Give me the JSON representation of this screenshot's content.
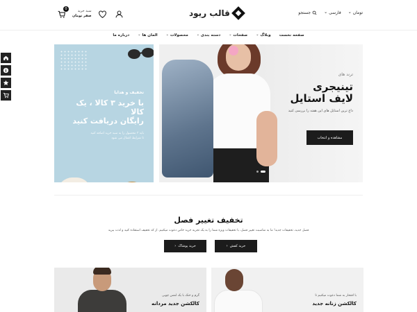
{
  "header": {
    "logo_text": "قالب ریود",
    "cart_label": "سبد خرید",
    "cart_amount": "صفر تومان",
    "cart_count": "0",
    "search_label": "جستجو",
    "language": "فارسی",
    "currency": "تومان"
  },
  "nav": {
    "items": [
      "صفحه نخست",
      "وبلاگ",
      "صفحات",
      "دسته بندی",
      "محصولات",
      "المان ها",
      "درباره ما"
    ]
  },
  "promo": {
    "subtitle": "تخفیف و هدایا",
    "title_line1": "با خرید ۳ کالا ، یک کالا",
    "title_line2": "رایگان دریافت کنید",
    "desc_line1": "باید ۳ محصول را به سبد خرید اضافه کنید",
    "desc_line2": "تا شرایط اعمال می شود"
  },
  "hero": {
    "kicker": "ترند های",
    "title_line1": "تینیجری",
    "title_line2": "لایف استایل",
    "desc": "داغ ترین استایل های این هفته را بررسی کنید",
    "cta": "مشاهده و انتخاب"
  },
  "season": {
    "title": "تخفیف تغییر فصل",
    "desc": "فصل جدید، تخفیفات جدید! ما به مناسبت تغییر فصل، با تخفیفات ویژه شما را به یک تجربه خرید خاص دعوت میکنیم. از کد تخفیف استفاده کنید و لذت ببرید",
    "btn_shoes": "خرید کفش",
    "btn_clothes": "خرید پوشاک"
  },
  "cards": {
    "men": {
      "subtitle": "گرم و خنک با یک لمس چوبی",
      "title": "کالکشن جدید مردانه"
    },
    "women": {
      "subtitle": "با افتخار به شما دعوت میکنیم تا",
      "title": "کالکشن زنانه جدید"
    }
  },
  "colors": {
    "accent": "#1c1c1c",
    "promo_bg": "#b7d5e2",
    "hero_bg": "#efefef"
  }
}
